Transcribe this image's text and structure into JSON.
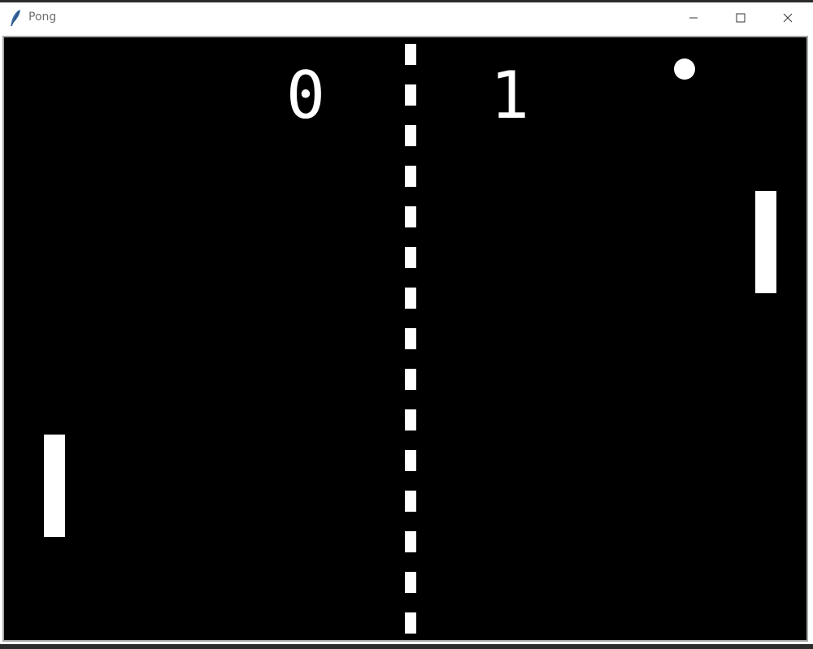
{
  "window": {
    "title": "Pong",
    "app_icon": "feather-icon",
    "controls": {
      "minimize": "minimize-icon",
      "maximize": "maximize-icon",
      "close": "close-icon"
    }
  },
  "game": {
    "background_color": "#000000",
    "foreground_color": "#ffffff",
    "score": {
      "left": "0",
      "right": "1"
    },
    "net": "dashed-center-line",
    "ball": "ball",
    "paddles": [
      "left-paddle",
      "right-paddle"
    ]
  }
}
